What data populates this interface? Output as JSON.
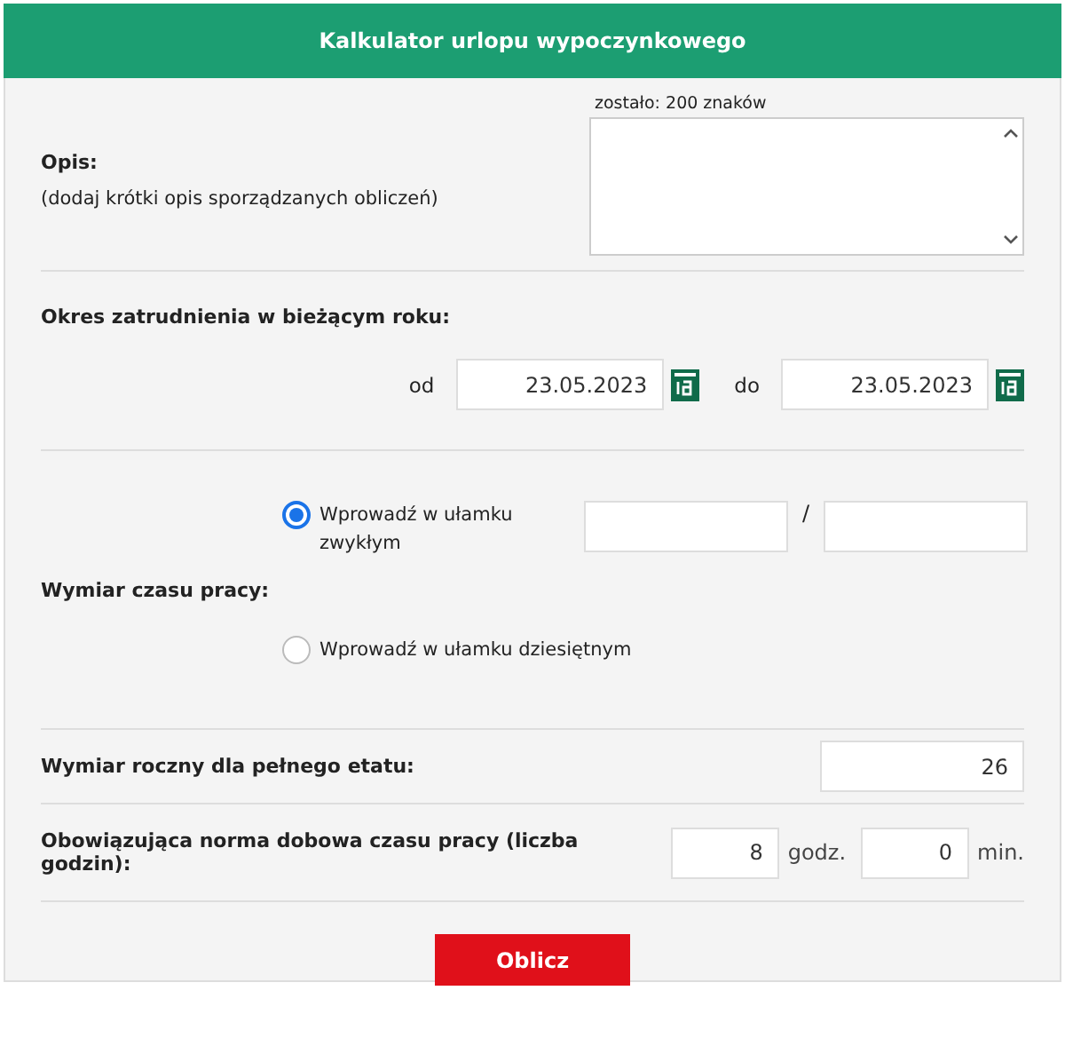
{
  "header": {
    "title": "Kalkulator urlopu wypoczynkowego"
  },
  "description": {
    "label": "Opis:",
    "hint": "(dodaj krótki opis sporządzanych obliczeń)",
    "counter": "zostało: 200 znaków"
  },
  "employment_period": {
    "label": "Okres zatrudnienia w bieżącym roku:",
    "from": {
      "label": "od",
      "value": "23.05.2023"
    },
    "to": {
      "label": "do",
      "value": "23.05.2023"
    }
  },
  "work_time": {
    "label": "Wymiar czasu pracy:",
    "separator": "/",
    "options": [
      {
        "kind": "fraction",
        "label": "Wprowadź w ułamku zwykłym",
        "selected": true
      },
      {
        "kind": "decimal",
        "label": "Wprowadź w ułamku dziesiętnym",
        "selected": false
      }
    ]
  },
  "annual_leave": {
    "label": "Wymiar roczny dla pełnego etatu:",
    "value": "26"
  },
  "daily_norm": {
    "label": "Obowiązująca norma dobowa czasu pracy (liczba godzin):",
    "hours": "8",
    "hours_unit": "godz.",
    "minutes": "0",
    "minutes_unit": "min."
  },
  "button": "Oblicz"
}
